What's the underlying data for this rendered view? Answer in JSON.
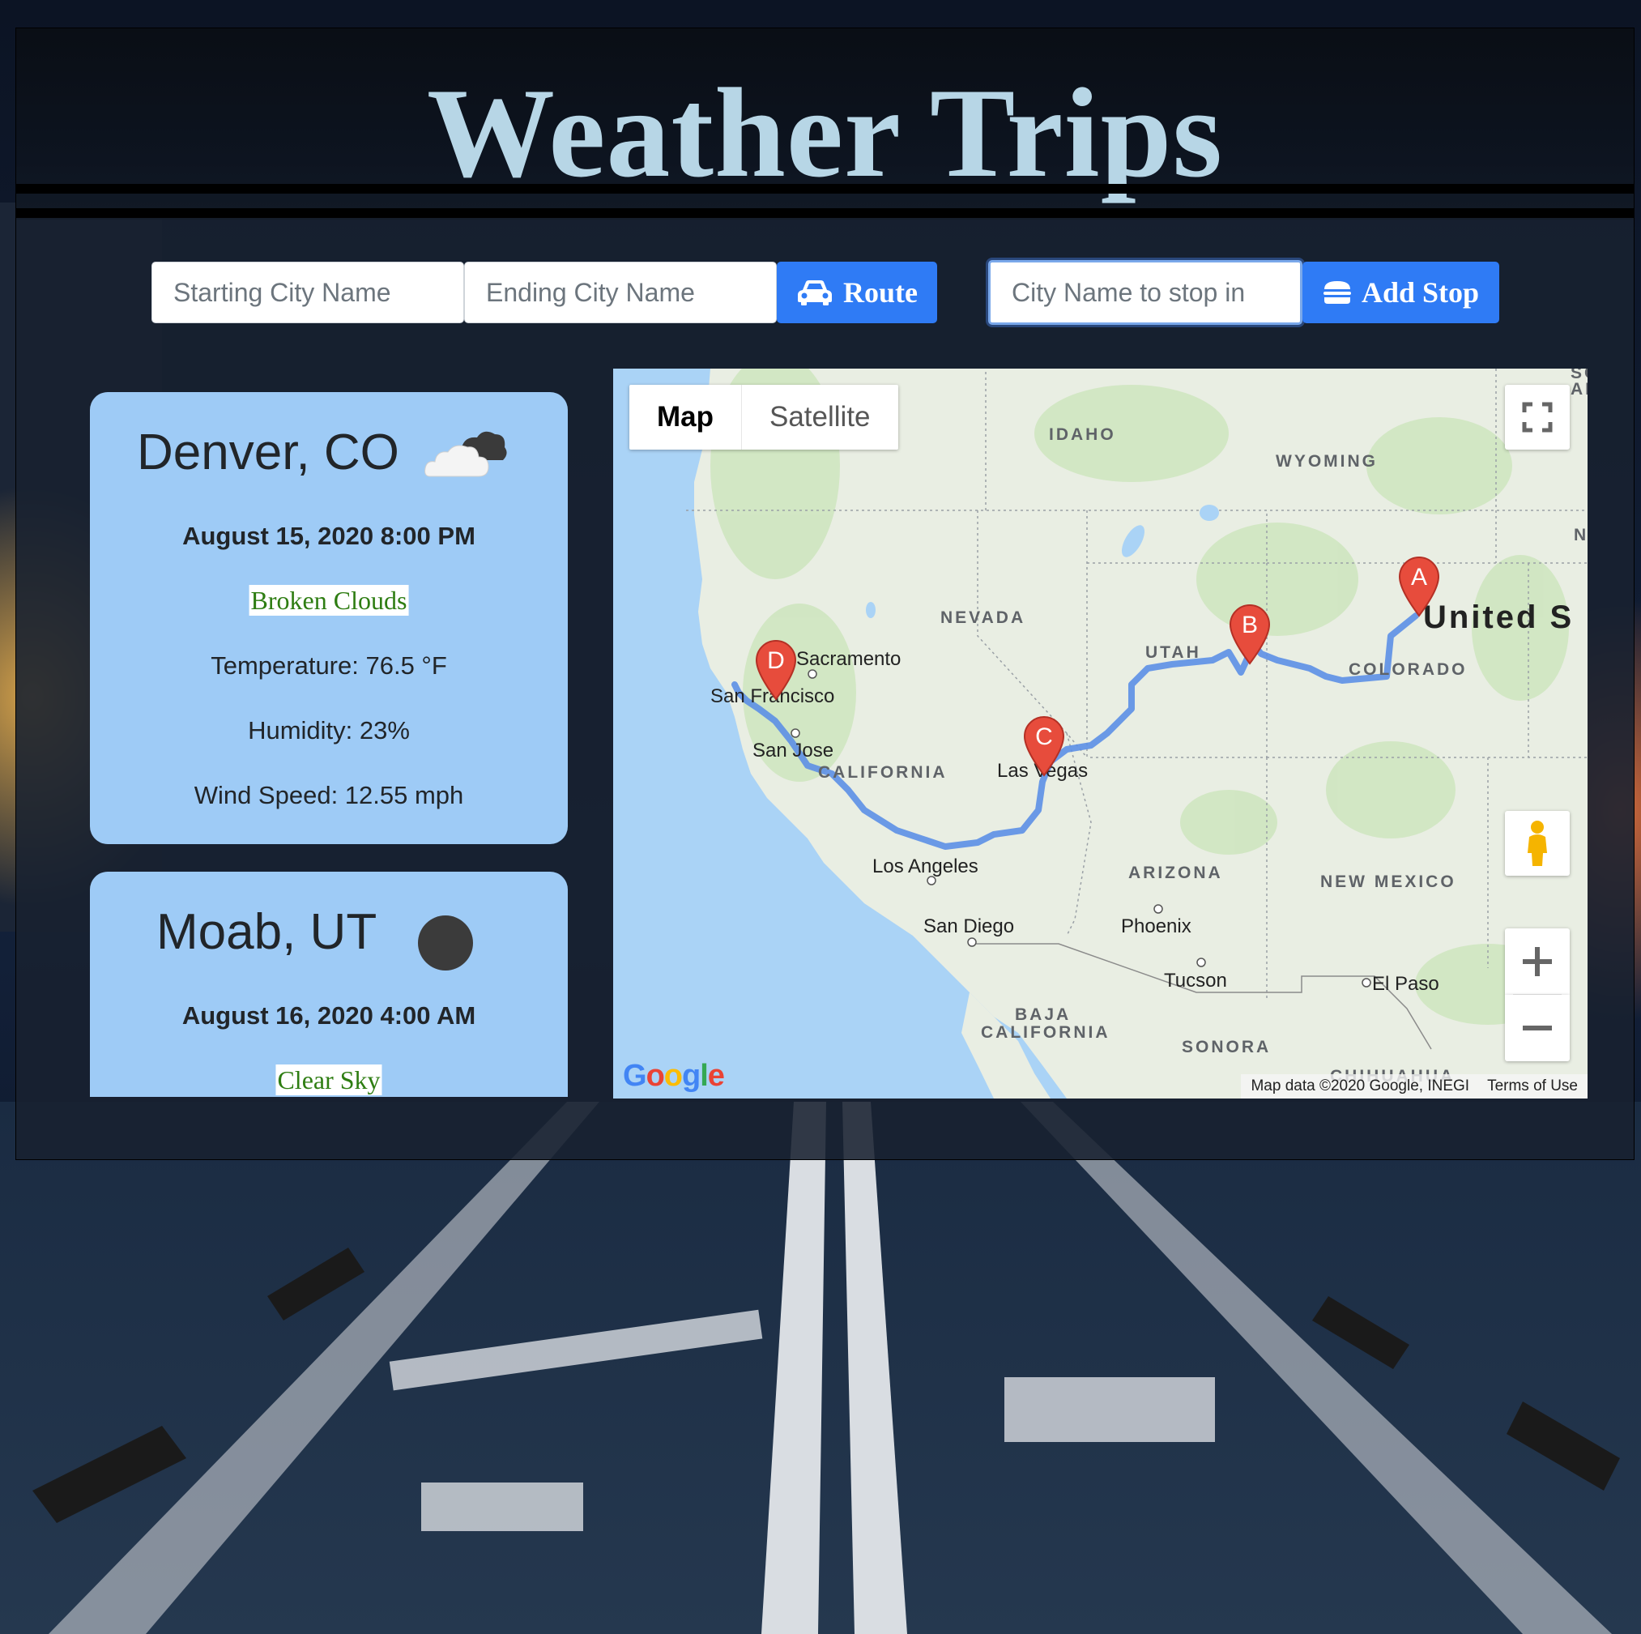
{
  "app": {
    "title": "Weather Trips"
  },
  "search": {
    "start_placeholder": "Starting City Name",
    "end_placeholder": "Ending City Name",
    "route_label": "Route",
    "route_icon": "car-icon",
    "stop_placeholder": "City Name to stop in",
    "add_stop_label": "Add Stop",
    "add_stop_icon": "hamburger-icon"
  },
  "weather": [
    {
      "city": "Denver, CO",
      "icon": "broken-clouds-icon",
      "datetime": "August 15, 2020 8:00 PM",
      "condition": "Broken Clouds",
      "temperature": "Temperature: 76.5 °F",
      "humidity": "Humidity: 23%",
      "wind": "Wind Speed: 12.55 mph"
    },
    {
      "city": "Moab, UT",
      "icon": "clear-sky-night-icon",
      "datetime": "August 16, 2020 4:00 AM",
      "condition": "Clear Sky"
    }
  ],
  "map": {
    "type_map": "Map",
    "type_satellite": "Satellite",
    "markers": [
      "A",
      "B",
      "C",
      "D"
    ],
    "labels": {
      "idaho": "IDAHO",
      "wyoming": "WYOMING",
      "nevada": "NEVADA",
      "utah": "UTAH",
      "colorado": "COLORADO",
      "california": "CALIFORNIA",
      "arizona": "ARIZONA",
      "new_mexico": "NEW MEXICO",
      "baja1": "BAJA",
      "baja2": "CALIFORNIA",
      "sonora": "SONORA",
      "chihuahua": "CHIHUAHUA",
      "sacramento": "Sacramento",
      "san_francisco": "San Francisco",
      "san_jose": "San Jose",
      "las_vegas": "Las Vegas",
      "los_angeles": "Los Angeles",
      "san_diego": "San Diego",
      "phoenix": "Phoenix",
      "tucson": "Tucson",
      "el_paso": "El Paso",
      "united_states": "United S",
      "edge_so": "SO",
      "edge_ak": "AK",
      "edge_n": "N"
    },
    "attribution": "Map data ©2020 Google, INEGI",
    "terms": "Terms of Use",
    "logo": "Google",
    "colors": {
      "route": "#5c8fe6",
      "marker": "#e74c3c",
      "button": "#2f7bf5",
      "card": "#9ecbf6",
      "title": "#b7d6e6"
    }
  }
}
